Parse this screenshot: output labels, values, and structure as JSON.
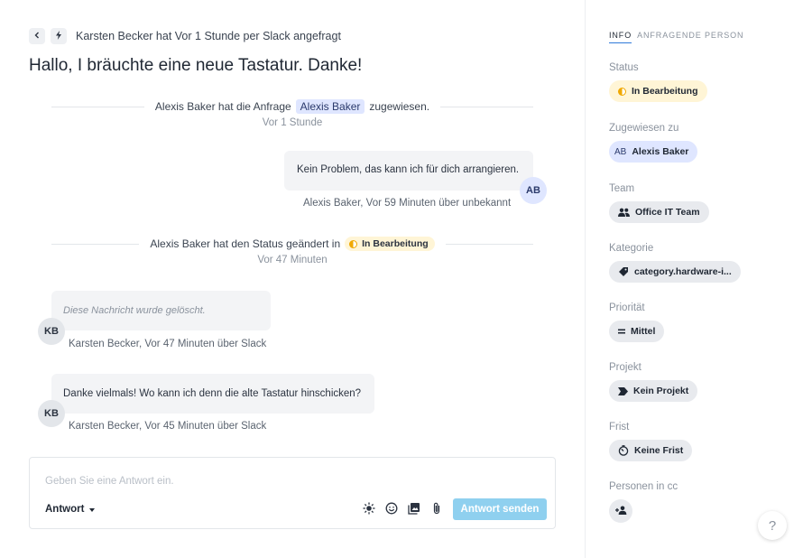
{
  "header": {
    "back_icon": "chevron-left-icon",
    "channel_icon": "bolt-icon",
    "requester_line": "Karsten Becker hat Vor 1 Stunde per Slack angefragt",
    "title": "Hallo, I bräuchte eine neue Tastatur. Danke!"
  },
  "events": [
    {
      "before": "Alexis Baker hat die Anfrage",
      "tag": "Alexis Baker",
      "after": "zugewiesen.",
      "time": "Vor 1 Stunde"
    },
    {
      "before": "Alexis Baker hat den Status geändert in",
      "tag": "In Bearbeitung",
      "time": "Vor 47 Minuten"
    }
  ],
  "messages": [
    {
      "text": "Kein Problem, das kann ich für dich arrangieren.",
      "avatar": "AB",
      "meta": "Alexis Baker, Vor 59 Minuten über unbekannt"
    },
    {
      "text": "Diese Nachricht wurde gelöscht.",
      "avatar": "KB",
      "meta": "Karsten Becker, Vor 47 Minuten über Slack"
    },
    {
      "text": "Danke vielmals! Wo kann ich denn die alte Tastatur hinschicken?",
      "avatar": "KB",
      "meta": "Karsten Becker, Vor 45 Minuten über Slack"
    }
  ],
  "composer": {
    "placeholder": "Geben Sie eine Antwort ein.",
    "reply_type": "Antwort",
    "send_label": "Antwort senden",
    "tools": [
      "sun-icon",
      "smiley-icon",
      "media-icon",
      "paperclip-icon"
    ]
  },
  "sidebar": {
    "tabs": [
      "INFO",
      "ANFRAGENDE PERSON"
    ],
    "status": {
      "label": "Status",
      "value": "In Bearbeitung"
    },
    "assignee": {
      "label": "Zugewiesen zu",
      "initials": "AB",
      "value": "Alexis Baker"
    },
    "team": {
      "label": "Team",
      "value": "Office IT Team"
    },
    "category": {
      "label": "Kategorie",
      "value": "category.hardware-i..."
    },
    "priority": {
      "label": "Priorität",
      "value": "Mittel"
    },
    "project": {
      "label": "Projekt",
      "value": "Kein Projekt"
    },
    "deadline": {
      "label": "Frist",
      "value": "Keine Frist"
    },
    "cc": {
      "label": "Personen in cc"
    }
  },
  "help": {
    "label": "?"
  },
  "colors": {
    "accent": "#2f7bd9",
    "send_button": "#8fd0ef",
    "status_yellow": "#f0a800",
    "assignee_blue": "#dfe6ff"
  }
}
